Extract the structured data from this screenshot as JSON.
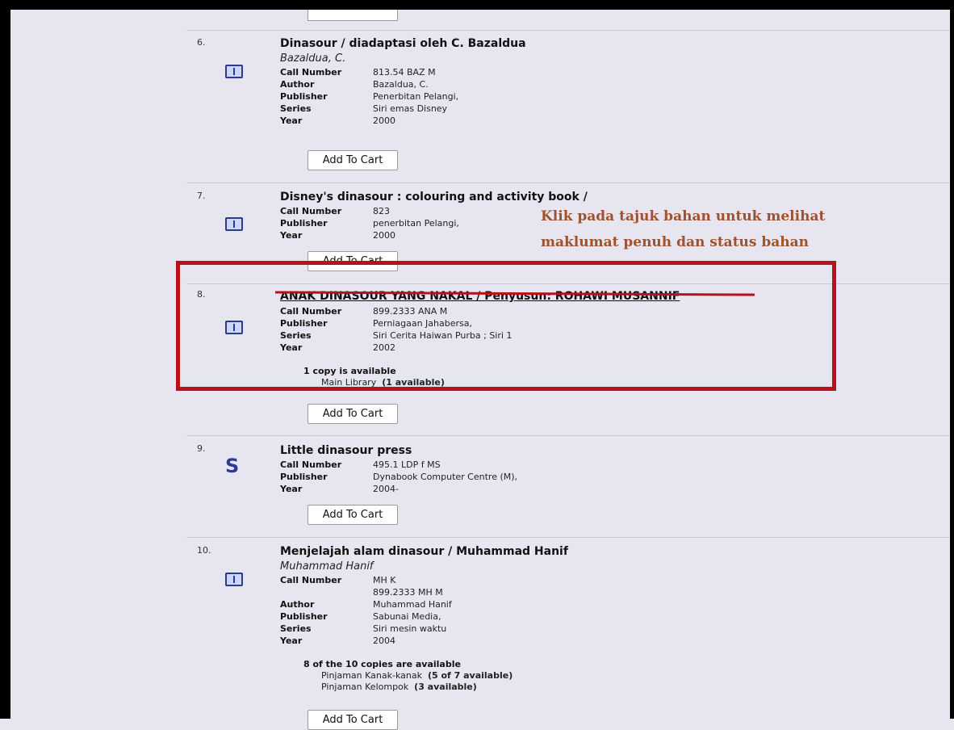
{
  "results": [
    {
      "number": "6.",
      "icon": "book-icon",
      "title": "Dinasour / diadaptasi oleh C. Bazaldua",
      "author_line": "Bazaldua, C.",
      "fields": [
        {
          "label": "Call Number",
          "value": "813.54 BAZ M"
        },
        {
          "label": "Author",
          "value": "Bazaldua, C."
        },
        {
          "label": "Publisher",
          "value": "Penerbitan Pelangi,"
        },
        {
          "label": "Series",
          "value": "Siri emas Disney"
        },
        {
          "label": "Year",
          "value": "2000"
        }
      ],
      "button": "Add To Cart"
    },
    {
      "number": "7.",
      "icon": "book-icon",
      "title": "Disney's dinasour : colouring and activity book /",
      "fields": [
        {
          "label": "Call Number",
          "value": "823"
        },
        {
          "label": "Publisher",
          "value": "penerbitan Pelangi,"
        },
        {
          "label": "Year",
          "value": "2000"
        }
      ],
      "button": "Add To Cart"
    },
    {
      "number": "8.",
      "icon": "book-icon",
      "title": "ANAK DINASOUR YANG NAKAL / Penyusun: ROHAWI MUSANNIF",
      "fields": [
        {
          "label": "Call Number",
          "value": "899.2333 ANA M"
        },
        {
          "label": "Publisher",
          "value": "Perniagaan Jahabersa,"
        },
        {
          "label": "Series",
          "value": "Siri Cerita Haiwan Purba ; Siri 1"
        },
        {
          "label": "Year",
          "value": "2002"
        }
      ],
      "availability": {
        "summary": "1 copy is available",
        "locations": [
          {
            "name": "Main Library",
            "count": "(1 available)"
          }
        ]
      },
      "button": "Add To Cart"
    },
    {
      "number": "9.",
      "icon": "serial-icon",
      "icon_glyph": "S",
      "title": "Little dinasour press",
      "fields": [
        {
          "label": "Call Number",
          "value": "495.1 LDP f MS"
        },
        {
          "label": "Publisher",
          "value": "Dynabook Computer Centre (M),"
        },
        {
          "label": "Year",
          "value": "2004-"
        }
      ],
      "button": "Add To Cart"
    },
    {
      "number": "10.",
      "icon": "book-icon",
      "title": "Menjelajah alam dinasour / Muhammad Hanif",
      "author_line": "Muhammad Hanif",
      "fields": [
        {
          "label": "Call Number",
          "value": "MH K"
        },
        {
          "label": "",
          "value": "899.2333 MH M"
        },
        {
          "label": "Author",
          "value": "Muhammad Hanif"
        },
        {
          "label": "Publisher",
          "value": "Sabunai Media,"
        },
        {
          "label": "Series",
          "value": "Siri mesin waktu"
        },
        {
          "label": "Year",
          "value": "2004"
        }
      ],
      "availability": {
        "summary": "8 of the 10 copies are available",
        "locations": [
          {
            "name": "Pinjaman Kanak-kanak",
            "count": "(5 of 7 available)"
          },
          {
            "name": "Pinjaman Kelompok",
            "count": "(3 available)"
          }
        ]
      },
      "button": "Add To Cart"
    }
  ],
  "annotation": {
    "line1": "Klik pada tajuk bahan untuk melihat",
    "line2": "maklumat penuh dan status bahan",
    "color": "#a0522d"
  },
  "highlight_color": "#b5121b"
}
